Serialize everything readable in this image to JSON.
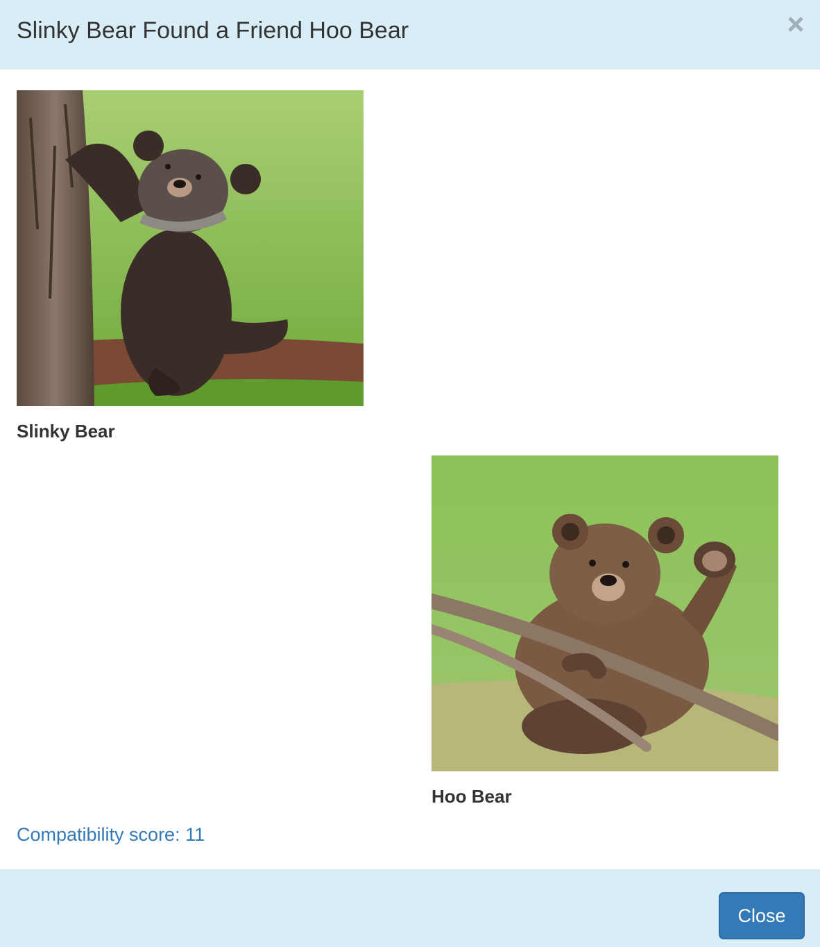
{
  "modal": {
    "title": "Slinky Bear Found a Friend Hoo Bear",
    "close_icon": "close-icon",
    "close_button_label": "Close"
  },
  "matches": [
    {
      "name": "Slinky Bear",
      "photo": "bear-cub-climbing-tree-photo"
    },
    {
      "name": "Hoo Bear",
      "photo": "bear-cub-waving-on-branch-photo"
    }
  ],
  "compatibility": {
    "label": "Compatibility score: 11"
  },
  "colors": {
    "header_bg": "#d9edf7",
    "link": "#337ab7",
    "primary_button": "#337ab7"
  }
}
